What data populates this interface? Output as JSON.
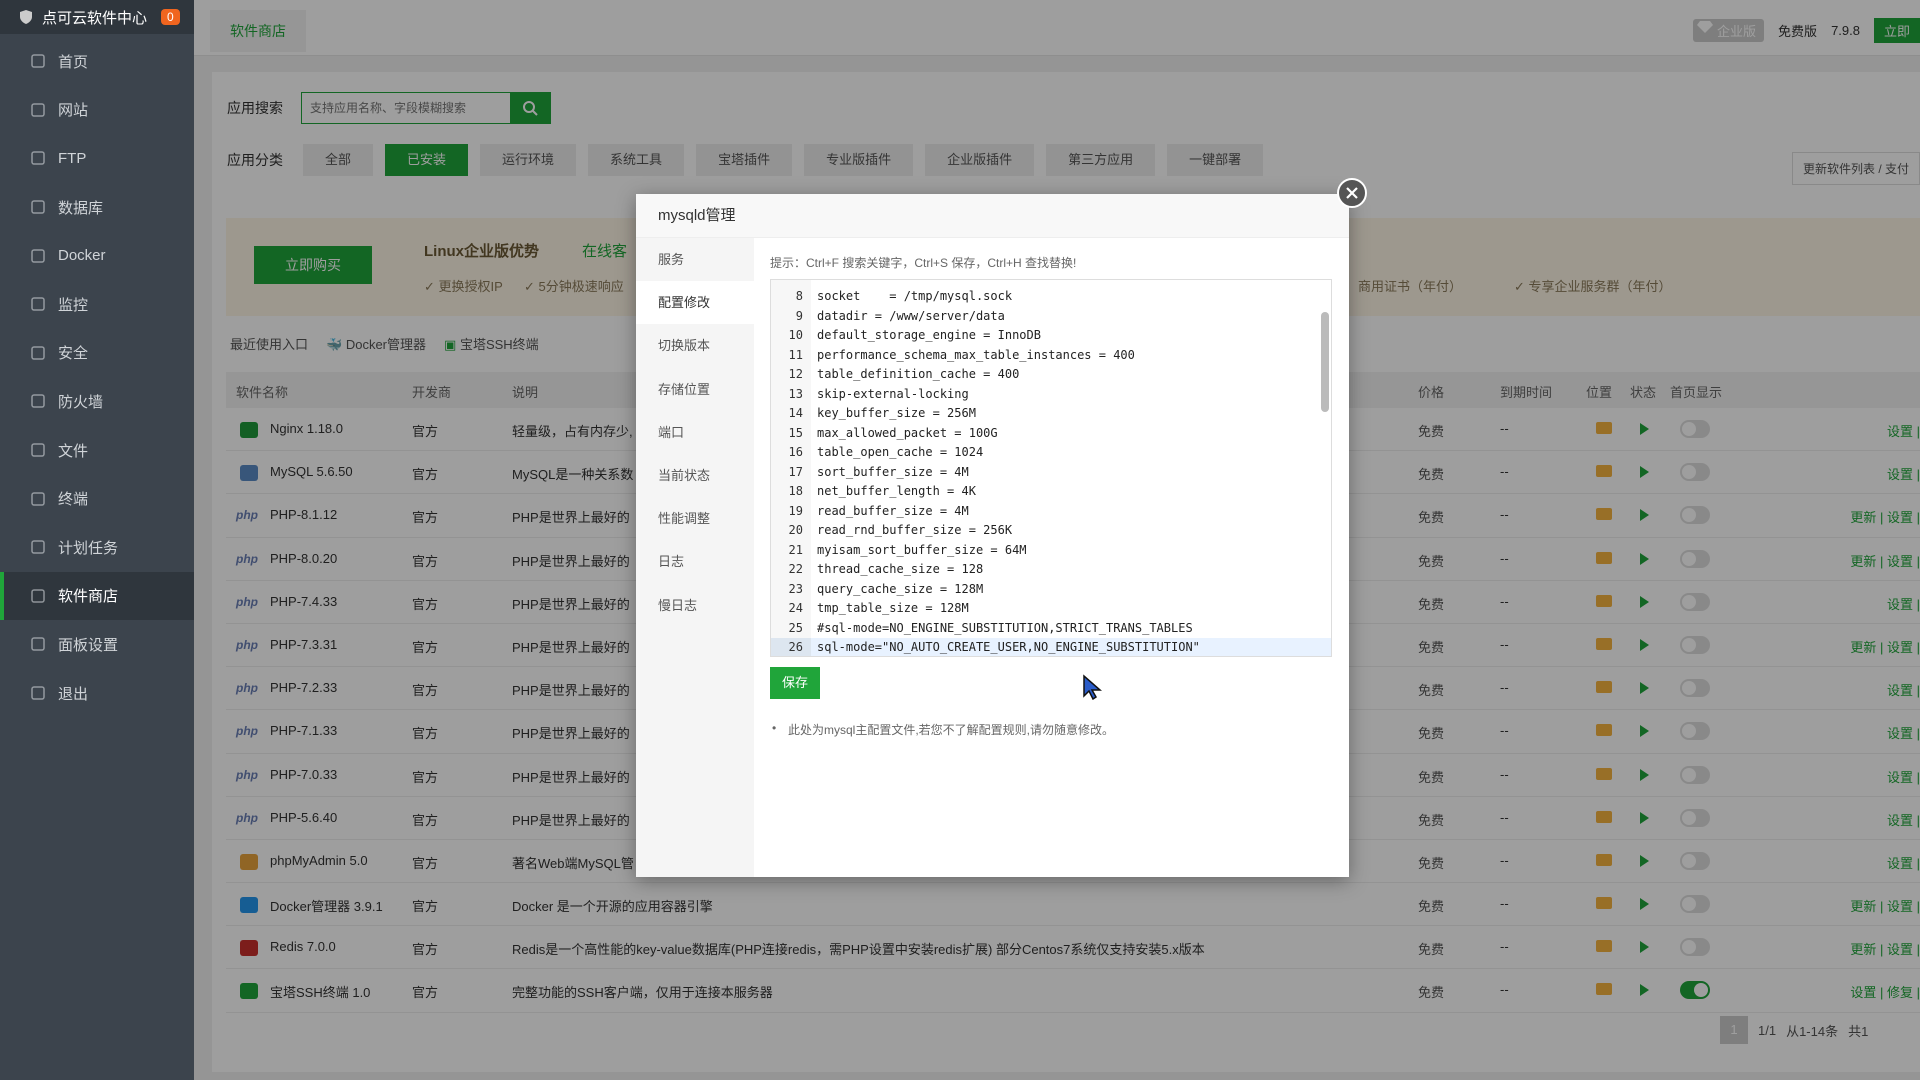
{
  "sidebar": {
    "brand": "点可云软件中心",
    "badge": "0",
    "items": [
      {
        "label": "首页",
        "icon": "home-icon"
      },
      {
        "label": "网站",
        "icon": "globe-icon"
      },
      {
        "label": "FTP",
        "icon": "ftp-icon"
      },
      {
        "label": "数据库",
        "icon": "database-icon"
      },
      {
        "label": "Docker",
        "icon": "docker-icon"
      },
      {
        "label": "监控",
        "icon": "monitor-icon"
      },
      {
        "label": "安全",
        "icon": "shield-icon"
      },
      {
        "label": "防火墙",
        "icon": "firewall-icon"
      },
      {
        "label": "文件",
        "icon": "folder-icon"
      },
      {
        "label": "终端",
        "icon": "terminal-icon"
      },
      {
        "label": "计划任务",
        "icon": "calendar-icon"
      },
      {
        "label": "软件商店",
        "icon": "grid-icon"
      },
      {
        "label": "面板设置",
        "icon": "gear-icon"
      },
      {
        "label": "退出",
        "icon": "logout-icon"
      }
    ]
  },
  "topbar": {
    "tab": "软件商店",
    "enterprise": "企业版",
    "free": "免费版",
    "version": "7.9.8",
    "buy": "立即"
  },
  "search": {
    "label": "应用搜索",
    "placeholder": "支持应用名称、字段模糊搜索"
  },
  "categories": {
    "label": "应用分类",
    "items": [
      "全部",
      "已安装",
      "运行环境",
      "系统工具",
      "宝塔插件",
      "专业版插件",
      "企业版插件",
      "第三方应用",
      "一键部署"
    ],
    "update_link": "更新软件列表 / 支付"
  },
  "promo": {
    "buy": "立即购买",
    "title": "Linux企业版优势",
    "online": "在线客",
    "f1": "更换授权IP",
    "f2": "5分钟极速响应",
    "f3": "商用证书（年付）",
    "f4": "专享企业服务群（年付）"
  },
  "quick": {
    "label": "最近使用入口",
    "docker": "Docker管理器",
    "ssh": "宝塔SSH终端"
  },
  "table": {
    "headers": {
      "name": "软件名称",
      "dev": "开发商",
      "desc": "说明",
      "price": "价格",
      "expire": "到期时间",
      "pos": "位置",
      "status": "状态",
      "home": "首页显示"
    },
    "rows": [
      {
        "name": "Nginx 1.18.0",
        "dev": "官方",
        "desc": "轻量级，占有内存少,",
        "price": "免费",
        "expire": "--",
        "ops": "设置 |",
        "logo": "nginx",
        "on": false
      },
      {
        "name": "MySQL 5.6.50",
        "dev": "官方",
        "desc": "MySQL是一种关系数",
        "price": "免费",
        "expire": "--",
        "ops": "设置 |",
        "logo": "mysql",
        "on": false
      },
      {
        "name": "PHP-8.1.12",
        "dev": "官方",
        "desc": "PHP是世界上最好的",
        "price": "免费",
        "expire": "--",
        "ops": "更新 | 设置 |",
        "logo": "php",
        "on": false
      },
      {
        "name": "PHP-8.0.20",
        "dev": "官方",
        "desc": "PHP是世界上最好的",
        "price": "免费",
        "expire": "--",
        "ops": "更新 | 设置 |",
        "logo": "php",
        "on": false
      },
      {
        "name": "PHP-7.4.33",
        "dev": "官方",
        "desc": "PHP是世界上最好的",
        "price": "免费",
        "expire": "--",
        "ops": "设置 |",
        "logo": "php",
        "on": false
      },
      {
        "name": "PHP-7.3.31",
        "dev": "官方",
        "desc": "PHP是世界上最好的",
        "price": "免费",
        "expire": "--",
        "ops": "更新 | 设置 |",
        "logo": "php",
        "on": false
      },
      {
        "name": "PHP-7.2.33",
        "dev": "官方",
        "desc": "PHP是世界上最好的",
        "price": "免费",
        "expire": "--",
        "ops": "设置 |",
        "logo": "php",
        "on": false
      },
      {
        "name": "PHP-7.1.33",
        "dev": "官方",
        "desc": "PHP是世界上最好的",
        "price": "免费",
        "expire": "--",
        "ops": "设置 |",
        "logo": "php",
        "on": false
      },
      {
        "name": "PHP-7.0.33",
        "dev": "官方",
        "desc": "PHP是世界上最好的",
        "price": "免费",
        "expire": "--",
        "ops": "设置 |",
        "logo": "php",
        "on": false
      },
      {
        "name": "PHP-5.6.40",
        "dev": "官方",
        "desc": "PHP是世界上最好的",
        "price": "免费",
        "expire": "--",
        "ops": "设置 |",
        "logo": "php",
        "on": false
      },
      {
        "name": "phpMyAdmin 5.0",
        "dev": "官方",
        "desc": "著名Web端MySQL管",
        "price": "免费",
        "expire": "--",
        "ops": "设置 |",
        "logo": "pma",
        "on": false
      },
      {
        "name": "Docker管理器 3.9.1",
        "dev": "官方",
        "desc": "Docker 是一个开源的应用容器引擎",
        "price": "免费",
        "expire": "--",
        "ops": "更新 | 设置 |",
        "logo": "docker",
        "on": false
      },
      {
        "name": "Redis 7.0.0",
        "dev": "官方",
        "desc": "Redis是一个高性能的key-value数据库(PHP连接redis，需PHP设置中安装redis扩展) 部分Centos7系统仅支持安装5.x版本",
        "price": "免费",
        "expire": "--",
        "ops": "更新 | 设置 |",
        "logo": "redis",
        "on": false
      },
      {
        "name": "宝塔SSH终端 1.0",
        "dev": "官方",
        "desc": "完整功能的SSH客户端，仅用于连接本服务器",
        "price": "免费",
        "expire": "--",
        "ops": "设置 | 修复 |",
        "logo": "ssh",
        "on": true
      }
    ]
  },
  "pager": {
    "current": "1",
    "total": "1/1",
    "range": "从1-14条",
    "count": "共1"
  },
  "modal": {
    "title": "mysqld管理",
    "menu": [
      "服务",
      "配置修改",
      "切换版本",
      "存储位置",
      "端口",
      "当前状态",
      "性能调整",
      "日志",
      "慢日志"
    ],
    "hint": "提示：Ctrl+F 搜索关键字，Ctrl+S 保存，Ctrl+H 查找替换!",
    "lines": [
      {
        "n": "8",
        "code": "socket    = /tmp/mysql.sock"
      },
      {
        "n": "9",
        "code": "datadir = /www/server/data"
      },
      {
        "n": "10",
        "code": "default_storage_engine = InnoDB"
      },
      {
        "n": "11",
        "code": "performance_schema_max_table_instances = 400"
      },
      {
        "n": "12",
        "code": "table_definition_cache = 400"
      },
      {
        "n": "13",
        "code": "skip-external-locking"
      },
      {
        "n": "14",
        "code": "key_buffer_size = 256M"
      },
      {
        "n": "15",
        "code": "max_allowed_packet = 100G"
      },
      {
        "n": "16",
        "code": "table_open_cache = 1024"
      },
      {
        "n": "17",
        "code": "sort_buffer_size = 4M"
      },
      {
        "n": "18",
        "code": "net_buffer_length = 4K"
      },
      {
        "n": "19",
        "code": "read_buffer_size = 4M"
      },
      {
        "n": "20",
        "code": "read_rnd_buffer_size = 256K"
      },
      {
        "n": "21",
        "code": "myisam_sort_buffer_size = 64M"
      },
      {
        "n": "22",
        "code": "thread_cache_size = 128"
      },
      {
        "n": "23",
        "code": "query_cache_size = 128M"
      },
      {
        "n": "24",
        "code": "tmp_table_size = 128M"
      },
      {
        "n": "25",
        "code": "#sql-mode=NO_ENGINE_SUBSTITUTION,STRICT_TRANS_TABLES"
      },
      {
        "n": "26",
        "code": "sql-mode=\"NO_AUTO_CREATE_USER,NO_ENGINE_SUBSTITUTION\""
      }
    ],
    "save": "保存",
    "note": "此处为mysql主配置文件,若您不了解配置规则,请勿随意修改。"
  }
}
